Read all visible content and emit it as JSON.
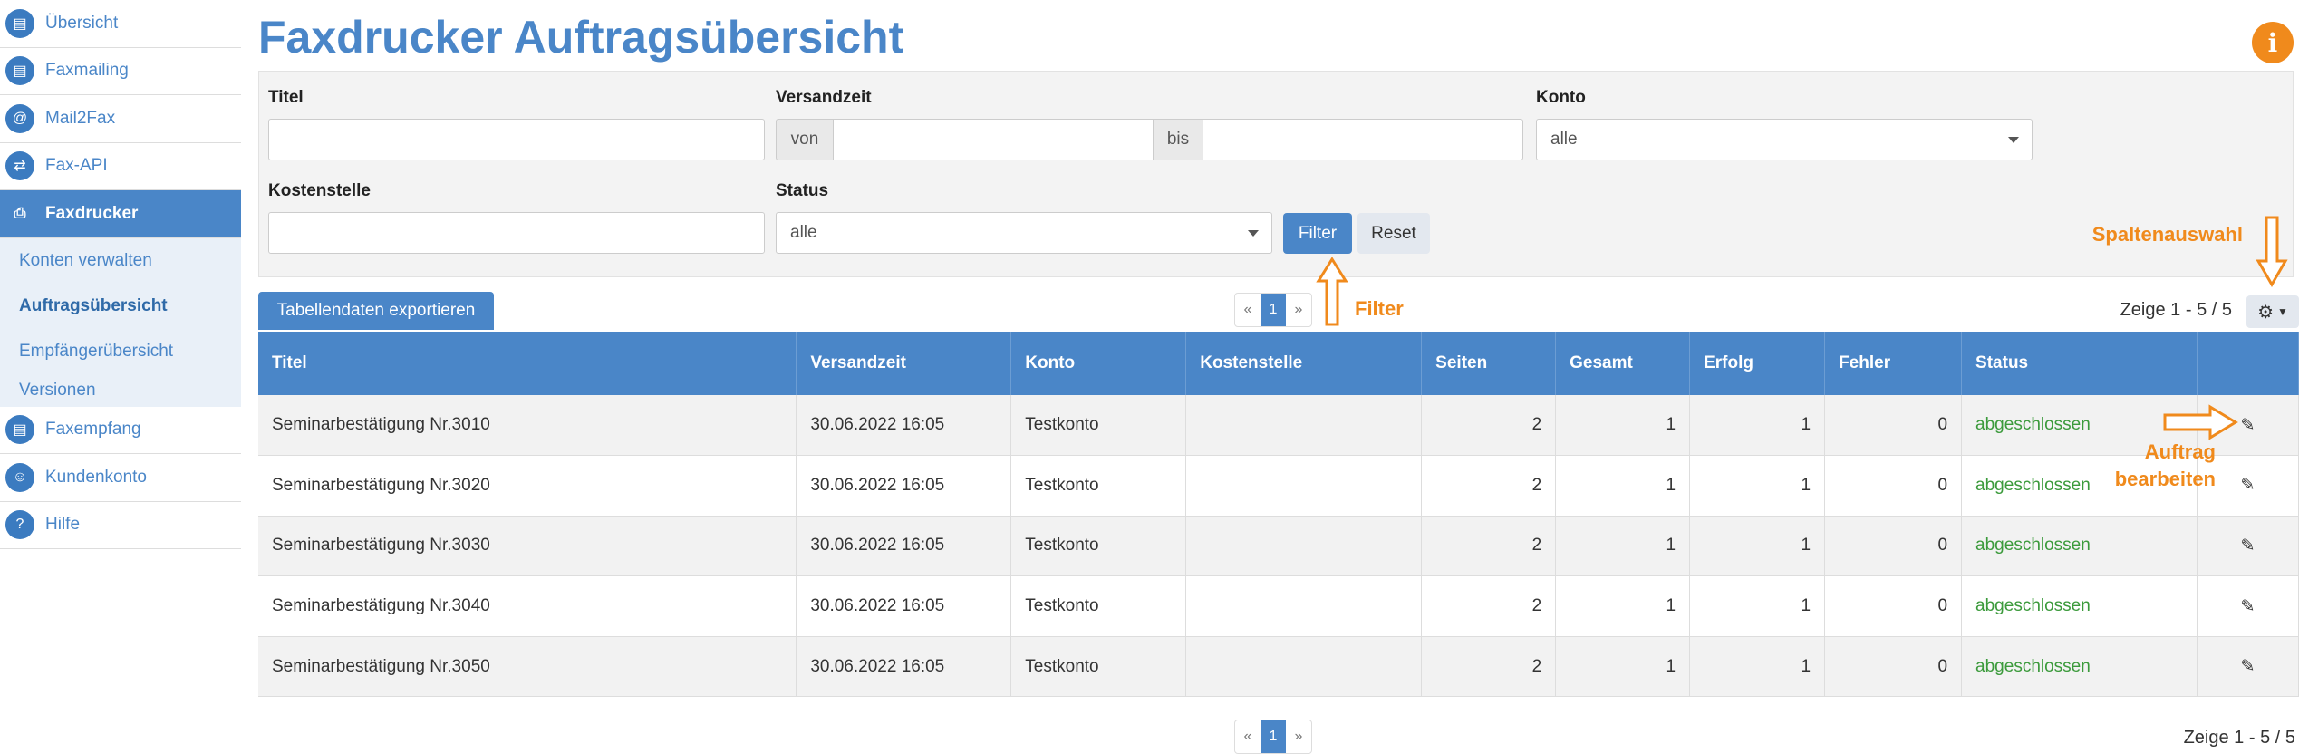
{
  "sidebar": {
    "items": [
      {
        "label": "Übersicht",
        "icon": "overview-icon"
      },
      {
        "label": "Faxmailing",
        "icon": "faxmailing-icon"
      },
      {
        "label": "Mail2Fax",
        "icon": "mail2fax-icon"
      },
      {
        "label": "Fax-API",
        "icon": "fax-api-icon"
      },
      {
        "label": "Faxdrucker",
        "icon": "faxprinter-icon"
      }
    ],
    "submenu": [
      "Konten verwalten",
      "Auftragsübersicht",
      "Empfängerübersicht",
      "Versionen"
    ],
    "items_after": [
      {
        "label": "Faxempfang",
        "icon": "fax-receive-icon"
      },
      {
        "label": "Kundenkonto",
        "icon": "customer-account-icon"
      },
      {
        "label": "Hilfe",
        "icon": "help-icon"
      }
    ]
  },
  "page": {
    "title": "Faxdrucker Auftragsübersicht",
    "info_icon": "i"
  },
  "filters": {
    "titel_label": "Titel",
    "titel_value": "",
    "versandzeit_label": "Versandzeit",
    "von": "von",
    "bis": "bis",
    "konto_label": "Konto",
    "konto_value": "alle",
    "kostenstelle_label": "Kostenstelle",
    "kostenstelle_value": "",
    "status_label": "Status",
    "status_value": "alle",
    "filter_button": "Filter",
    "reset_button": "Reset"
  },
  "toolbar": {
    "export_button": "Tabellendaten exportieren",
    "showing": "Zeige 1 - 5 / 5",
    "pager": {
      "prev": "«",
      "current": "1",
      "next": "»"
    }
  },
  "table": {
    "columns": [
      "Titel",
      "Versandzeit",
      "Konto",
      "Kostenstelle",
      "Seiten",
      "Gesamt",
      "Erfolg",
      "Fehler",
      "Status",
      ""
    ],
    "rows": [
      [
        "Seminarbestätigung Nr.3010",
        "30.06.2022 16:05",
        "Testkonto",
        "",
        "2",
        "1",
        "1",
        "0",
        "abgeschlossen"
      ],
      [
        "Seminarbestätigung Nr.3020",
        "30.06.2022 16:05",
        "Testkonto",
        "",
        "2",
        "1",
        "1",
        "0",
        "abgeschlossen"
      ],
      [
        "Seminarbestätigung Nr.3030",
        "30.06.2022 16:05",
        "Testkonto",
        "",
        "2",
        "1",
        "1",
        "0",
        "abgeschlossen"
      ],
      [
        "Seminarbestätigung Nr.3040",
        "30.06.2022 16:05",
        "Testkonto",
        "",
        "2",
        "1",
        "1",
        "0",
        "abgeschlossen"
      ],
      [
        "Seminarbestätigung Nr.3050",
        "30.06.2022 16:05",
        "Testkonto",
        "",
        "2",
        "1",
        "1",
        "0",
        "abgeschlossen"
      ]
    ]
  },
  "annotations": {
    "filter": "Filter",
    "spaltenauswahl": "Spaltenauswahl",
    "auftrag": "Auftrag",
    "bearbeiten": "bearbeiten"
  },
  "colors": {
    "primary": "#4a86c8",
    "accent": "#f08a1c",
    "status_done": "#3b9a3b"
  }
}
